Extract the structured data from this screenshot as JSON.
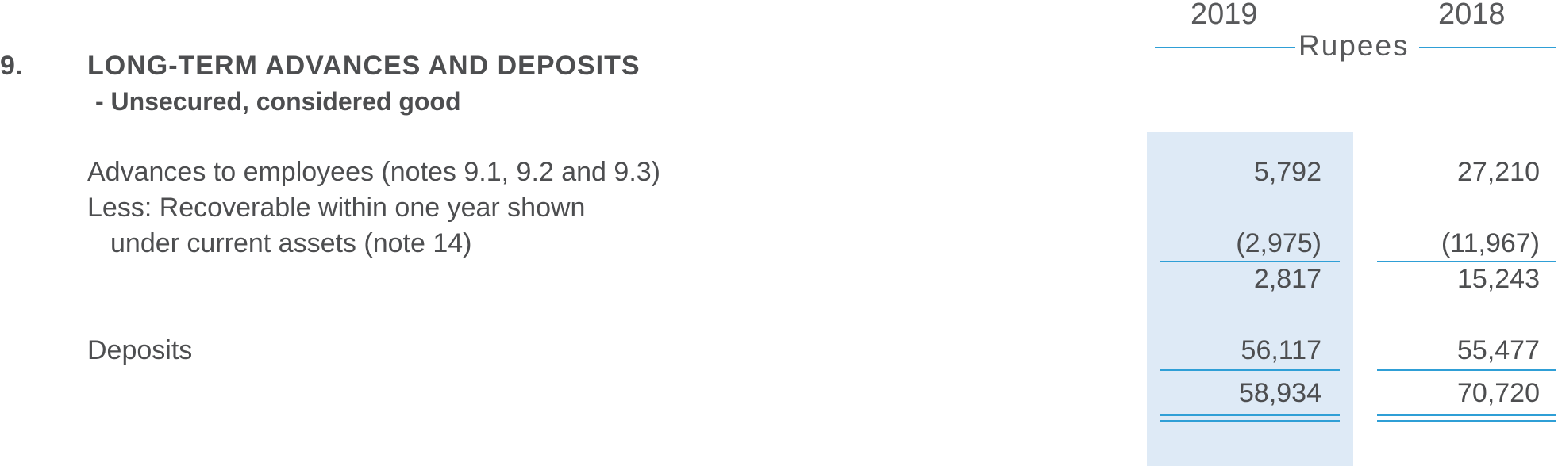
{
  "header": {
    "year_current": "2019",
    "year_prior": "2018",
    "unit": "Rupees"
  },
  "note": {
    "number": "9.",
    "title": "LONG-TERM ADVANCES AND DEPOSITS",
    "subtitle": "- Unsecured, considered good"
  },
  "rows": {
    "advances": {
      "label": "Advances to employees (notes 9.1, 9.2 and  9.3)",
      "y2019": "5,792",
      "y2018": "27,210"
    },
    "less_line1": {
      "label": "Less: Recoverable within one year shown"
    },
    "less_line2": {
      "label": "under current assets (note 14)",
      "y2019": "(2,975)",
      "y2018": "(11,967)"
    },
    "subtotal": {
      "y2019": "2,817",
      "y2018": "15,243"
    },
    "deposits": {
      "label": "Deposits",
      "y2019": "56,117",
      "y2018": "55,477"
    },
    "total": {
      "y2019": "58,934",
      "y2018": "70,720"
    }
  }
}
